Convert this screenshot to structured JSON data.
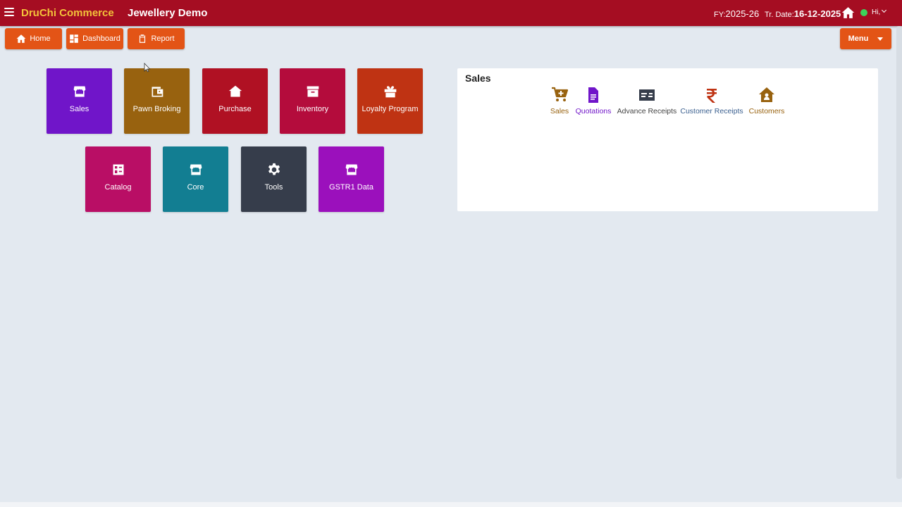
{
  "header": {
    "brand": "DruChi Commerce",
    "org": "Jewellery Demo",
    "fy_label": "FY:",
    "fy_value": "2025-26",
    "tr_label": "Tr. Date:",
    "tr_value": "16-12-2025",
    "user": "Hi,",
    "colors": {
      "bar": "#a50d22",
      "brand": "#f3c23a",
      "online": "#3ed35a"
    }
  },
  "toolbar": {
    "home": "Home",
    "dashboard": "Dashboard",
    "report": "Report",
    "menu": "Menu",
    "color": "#e35416"
  },
  "tiles": [
    {
      "label": "Sales",
      "icon": "store-icon",
      "color": "#7015c9"
    },
    {
      "label": "Pawn Broking",
      "icon": "wallet-icon",
      "color": "#98620f"
    },
    {
      "label": "Purchase",
      "icon": "house-cart-icon",
      "color": "#b01123"
    },
    {
      "label": "Inventory",
      "icon": "archive-icon",
      "color": "#b40c3c"
    },
    {
      "label": "Loyalty Program",
      "icon": "gift-icon",
      "color": "#bf3313"
    },
    {
      "label": "Catalog",
      "icon": "catalog-icon",
      "color": "#b90e65"
    },
    {
      "label": "Core",
      "icon": "store-icon",
      "color": "#127e92"
    },
    {
      "label": "Tools",
      "icon": "gear-icon",
      "color": "#363d4b"
    },
    {
      "label": "GSTR1 Data",
      "icon": "store-icon",
      "color": "#9b10bc"
    }
  ],
  "panel": {
    "title": "Sales",
    "items": [
      {
        "label": "Sales",
        "icon": "cart-plus-icon",
        "color": "#98620f"
      },
      {
        "label": "Quotations",
        "icon": "document-icon",
        "color": "#7015c9"
      },
      {
        "label": "Advance Receipts",
        "icon": "id-card-icon",
        "color": "#363d4b"
      },
      {
        "label": "Customer Receipts",
        "icon": "rupee-icon",
        "color": "#bf3313"
      },
      {
        "label": "Customers",
        "icon": "house-user-icon",
        "color": "#98620f"
      }
    ]
  }
}
